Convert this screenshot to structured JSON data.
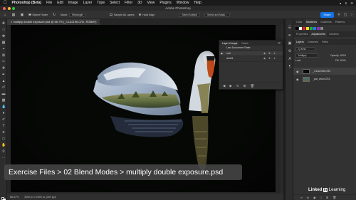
{
  "menubar": {
    "items": [
      "Photoshop (Beta)",
      "File",
      "Edit",
      "Image",
      "Layer",
      "Type",
      "Select",
      "Filter",
      "3D",
      "View",
      "Plugins",
      "Window",
      "Help"
    ]
  },
  "titlebar": {
    "title": "Adobe Photoshop"
  },
  "options": {
    "object_finder": "Object Finder",
    "shape": "Rectangle",
    "sample_all_layers": "Sample All Layers",
    "hard_edge": "Hard Edge",
    "select_subject": "Select Subject",
    "select_and_mask": "Select and Mask...",
    "share": "Share"
  },
  "document": {
    "tab_title": "multiply double exposure.psd @ 66.7% (_C1A2196.CR2, RGB/8*)",
    "zoom": "66.67%",
    "dimensions": "3000 px x 2000 px (300 ppi)"
  },
  "layer_comps": {
    "tabs": [
      "Layer Comps",
      "Notes"
    ],
    "last_state": "Last Document State",
    "rows": [
      "snit",
      "dhd11"
    ]
  },
  "right_panel": {
    "top_tabs": [
      "Color",
      "Swatches",
      "Gradients",
      "Patterns"
    ],
    "mid_tabs": [
      "Properties",
      "Adjustments",
      "Libraries"
    ],
    "layer_tabs": [
      "Layers",
      "Channels",
      "Paths"
    ],
    "kind": "Q Kind",
    "blend_mode": "Multiply",
    "opacity": "Opacity: 100%",
    "lock": "Lock:",
    "fill": "Fill: 100%",
    "layers": [
      "_C1A2196.CR2",
      "_pal_dncd.CR2"
    ]
  },
  "caption": "Exercise Files > 02 Blend Modes > multiply double exposure.psd",
  "branding": {
    "linkedin": "Linked",
    "in": "in",
    "learning": "Learning"
  }
}
